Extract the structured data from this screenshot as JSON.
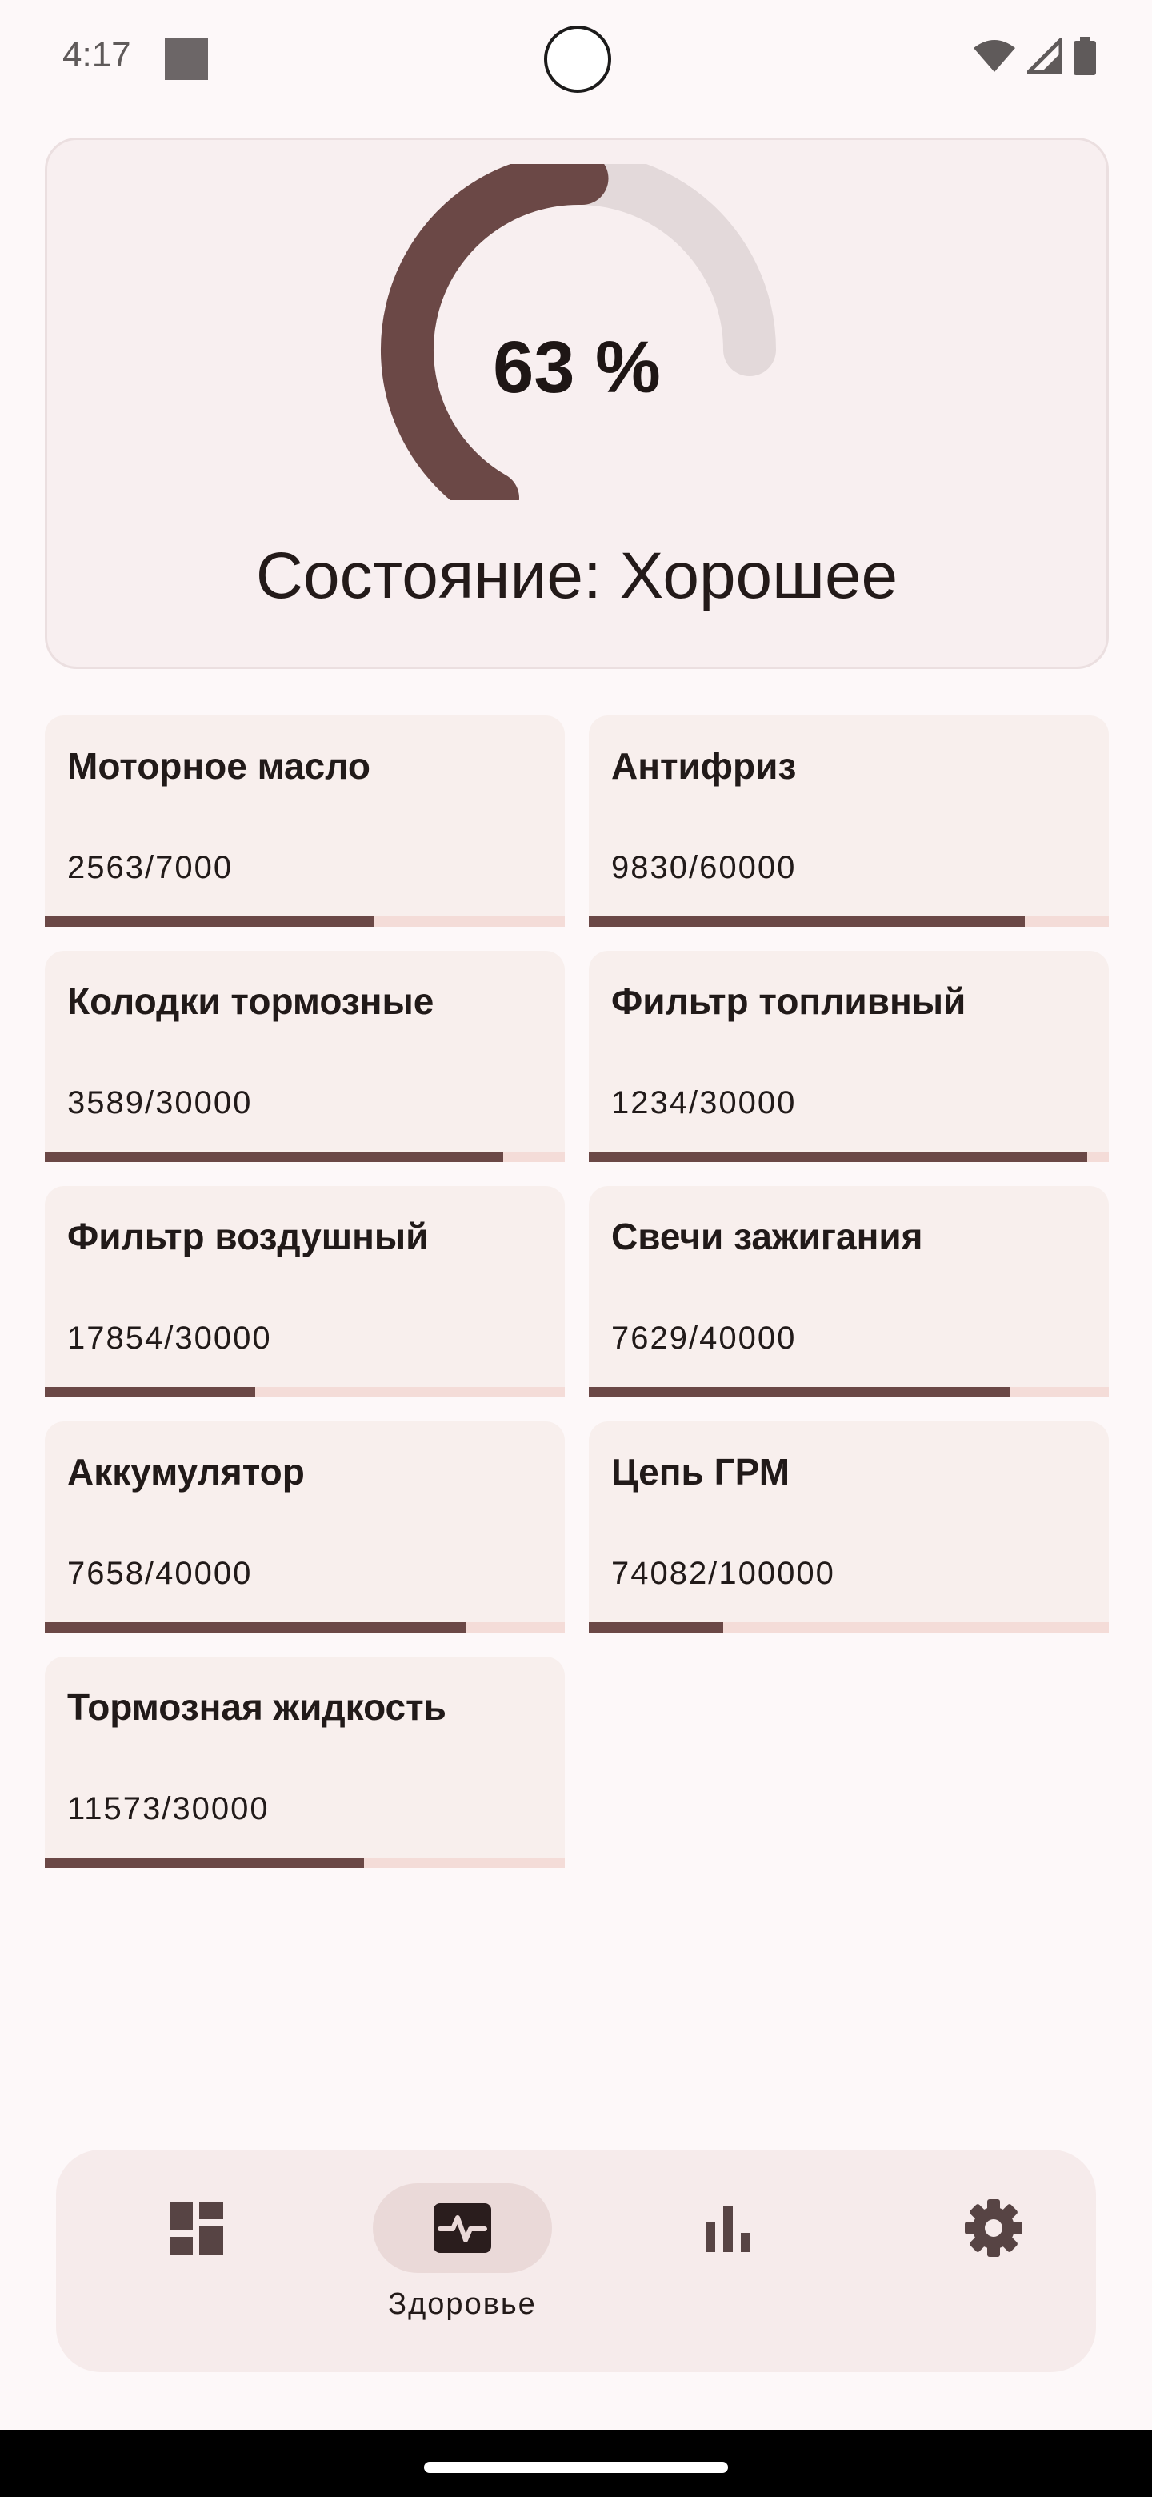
{
  "status_bar": {
    "time": "4:17"
  },
  "gauge": {
    "percent_text": "63 %",
    "percent": 63,
    "status_text": "Состояние: Хорошее",
    "colors": {
      "fill": "#6b4846",
      "track": "#e3d9da"
    }
  },
  "items": [
    {
      "title": "Моторное масло",
      "value": "2563/7000",
      "progress": 0.634
    },
    {
      "title": "Антифриз",
      "value": "9830/60000",
      "progress": 0.838
    },
    {
      "title": "Колодки тормозные",
      "value": "3589/30000",
      "progress": 0.881
    },
    {
      "title": "Фильтр топливный",
      "value": "1234/30000",
      "progress": 0.959
    },
    {
      "title": "Фильтр воздушный",
      "value": "17854/30000",
      "progress": 0.405
    },
    {
      "title": "Свечи зажигания",
      "value": "7629/40000",
      "progress": 0.809
    },
    {
      "title": "Аккумулятор",
      "value": "7658/40000",
      "progress": 0.809
    },
    {
      "title": "Цепь ГРМ",
      "value": "74082/100000",
      "progress": 0.259
    },
    {
      "title": "Тормозная жидкость",
      "value": "11573/30000",
      "progress": 0.614
    }
  ],
  "bottom_nav": {
    "items": [
      {
        "icon": "dashboard-icon",
        "label": ""
      },
      {
        "icon": "monitor-heart-icon",
        "label": "Здоровье",
        "active": true
      },
      {
        "icon": "bar-chart-icon",
        "label": ""
      },
      {
        "icon": "gear-icon",
        "label": ""
      }
    ]
  }
}
